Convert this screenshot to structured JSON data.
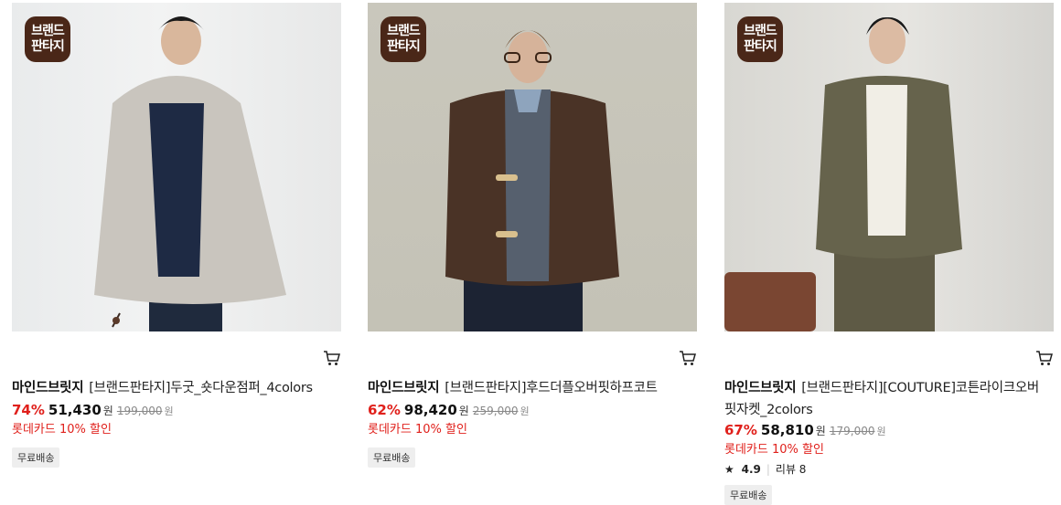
{
  "badge_text": [
    "브랜드",
    "판타지"
  ],
  "products": [
    {
      "brand": "마인드브릿지",
      "name": "[브랜드판타지]두굿_숏다운점퍼_4colors",
      "discount": "74%",
      "price": "51,430",
      "currency": "원",
      "original_price": "199,000",
      "card_promo": "롯데카드 10% 할인",
      "shipping": "무료배송"
    },
    {
      "brand": "마인드브릿지",
      "name": "[브랜드판타지]후드더플오버핏하프코트",
      "discount": "62%",
      "price": "98,420",
      "currency": "원",
      "original_price": "259,000",
      "card_promo": "롯데카드 10% 할인",
      "shipping": "무료배송"
    },
    {
      "brand": "마인드브릿지",
      "name": "[브랜드판타지][COUTURE]코튼라이크오버핏자켓_2colors",
      "discount": "67%",
      "price": "58,810",
      "currency": "원",
      "original_price": "179,000",
      "card_promo": "롯데카드 10% 할인",
      "rating": "4.9",
      "review_label": "리뷰 8",
      "shipping": "무료배송"
    }
  ],
  "icons": {
    "cart": "cart-icon",
    "star": "star-icon"
  },
  "colors": {
    "discount": "#e0201b",
    "badge_bg": "#4a2718"
  }
}
